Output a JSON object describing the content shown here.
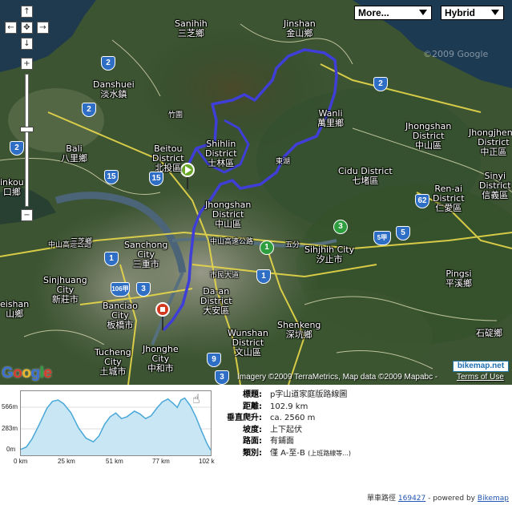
{
  "map": {
    "type_buttons": {
      "more": "More...",
      "hybrid": "Hybrid"
    },
    "watermark": "©2009 Google",
    "google_logo": [
      "G",
      "o",
      "o",
      "g",
      "l",
      "e"
    ],
    "copyright": "Imagery ©2009 TerraMetrics, Map data ©2009 Mapabc -",
    "terms": "Terms of Use",
    "bikemap_badge": "bikemap.net",
    "labels": [
      {
        "id": "sanihih",
        "text": "Sanihih\n三芝鄉"
      },
      {
        "id": "jinshan",
        "text": "Jinshan\n金山鄉"
      },
      {
        "id": "danshuei",
        "text": "Danshuei\n淡水鎮"
      },
      {
        "id": "wanli",
        "text": "Wanli\n萬里鄉"
      },
      {
        "id": "jhongshan-n",
        "text": "Jhongshan\nDistrict\n中山區"
      },
      {
        "id": "jhongjheng",
        "text": "Jhongjheng\nDistrict\n中正區"
      },
      {
        "id": "bali",
        "text": "Bali\n八里鄉"
      },
      {
        "id": "beitou",
        "text": "Beitou\nDistrict\n北投區"
      },
      {
        "id": "shihlin",
        "text": "Shihlin\nDistrict\n士林區"
      },
      {
        "id": "cidu",
        "text": "Cidu District\n七堵區"
      },
      {
        "id": "sinyi",
        "text": "Sinyi\nDistrict\n信義區"
      },
      {
        "id": "renai",
        "text": "Ren-ai\nDistrict\n仁愛區"
      },
      {
        "id": "linkou",
        "text": "inkou\n口鄉"
      },
      {
        "id": "jhongshan-t",
        "text": "Jhongshan\nDistrict\n中山區"
      },
      {
        "id": "sanchong",
        "text": "Sanchong\nCity\n三重市"
      },
      {
        "id": "sihjhih",
        "text": "Sihjhih City\n汐止市"
      },
      {
        "id": "sinjhuang",
        "text": "Sinjhuang\nCity\n新莊市"
      },
      {
        "id": "daan",
        "text": "Da-an\nDistrict\n大安區"
      },
      {
        "id": "pingsi",
        "text": "Pingsi\n平溪鄉"
      },
      {
        "id": "shuishan",
        "text": "eishan\n山鄉"
      },
      {
        "id": "banciao",
        "text": "Banciao\nCity\n板橋市"
      },
      {
        "id": "shenkeng",
        "text": "Shenkeng\n深坑鄉"
      },
      {
        "id": "wunshan",
        "text": "Wunshan\nDistrict\n文山區"
      },
      {
        "id": "tucheng",
        "text": "Tucheng\nCity\n土城市"
      },
      {
        "id": "jhonghe",
        "text": "Jhonghe\nCity\n中和市"
      },
      {
        "id": "shiding",
        "text": "石碇鄉"
      }
    ],
    "roads": [
      {
        "id": "r-jhongshan-hwy",
        "text": "中山高速公路"
      },
      {
        "id": "r-jhongshan-hwy-w",
        "text": "中山高速公路"
      },
      {
        "id": "r-shimin",
        "text": "市民大道"
      },
      {
        "id": "r-wufen",
        "text": "五分"
      },
      {
        "id": "r-donghu",
        "text": "東湖"
      },
      {
        "id": "r-sanjhih",
        "text": "三芝鄉"
      },
      {
        "id": "r-jhuwei",
        "text": "竹圍"
      }
    ],
    "shields": [
      "2",
      "2",
      "2",
      "2",
      "15",
      "15",
      "1",
      "1",
      "3",
      "106甲",
      "3",
      "5甲",
      "5",
      "62",
      "9",
      "3",
      "1"
    ]
  },
  "elevation": {
    "y_ticks": [
      "566m",
      "283m",
      "0m"
    ],
    "x_ticks": [
      "0 km",
      "25 km",
      "51 km",
      "77 km",
      "102 k"
    ],
    "profile": [
      [
        0,
        30
      ],
      [
        3,
        55
      ],
      [
        6,
        140
      ],
      [
        10,
        300
      ],
      [
        14,
        470
      ],
      [
        17,
        545
      ],
      [
        20,
        560
      ],
      [
        23,
        520
      ],
      [
        27,
        420
      ],
      [
        31,
        260
      ],
      [
        35,
        150
      ],
      [
        39,
        110
      ],
      [
        42,
        175
      ],
      [
        45,
        300
      ],
      [
        48,
        380
      ],
      [
        51,
        420
      ],
      [
        54,
        360
      ],
      [
        57,
        380
      ],
      [
        61,
        440
      ],
      [
        64,
        410
      ],
      [
        67,
        360
      ],
      [
        70,
        390
      ],
      [
        73,
        470
      ],
      [
        76,
        540
      ],
      [
        79,
        570
      ],
      [
        82,
        520
      ],
      [
        84,
        480
      ],
      [
        86,
        560
      ],
      [
        88,
        580
      ],
      [
        91,
        500
      ],
      [
        94,
        380
      ],
      [
        97,
        230
      ],
      [
        100,
        90
      ],
      [
        102,
        20
      ]
    ],
    "max_km": 102,
    "max_m": 620
  },
  "info": [
    {
      "key": "標題:",
      "value": "p字山道家庭版路線圖"
    },
    {
      "key": "距離:",
      "value": "102.9 km"
    },
    {
      "key": "垂直爬升:",
      "value": "ca. 2560 m"
    },
    {
      "key": "坡度:",
      "value": "上下起伏"
    },
    {
      "key": "路面:",
      "value": "有鋪面"
    },
    {
      "key": "類別:",
      "value": "僅 A-至-B",
      "small": "(上班路線等...)"
    }
  ],
  "footer": {
    "prefix": "單車路徑",
    "route_id": "169427",
    "powered": "- powered by",
    "brand": "Bikemap"
  },
  "colors": {
    "route": "#3f3fd8",
    "elev_line": "#4aa8d8",
    "elev_fill": "#c9e6f4"
  }
}
